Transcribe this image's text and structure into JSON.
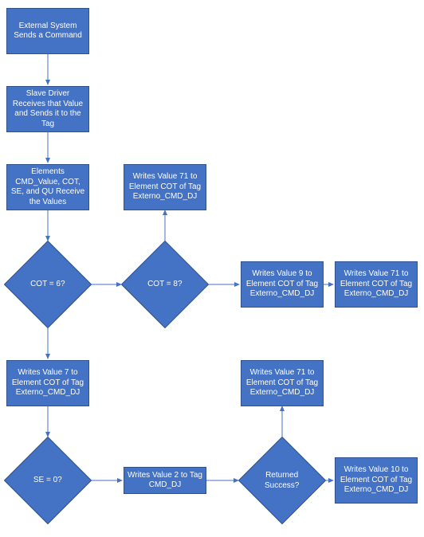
{
  "nodes": {
    "n1": "External System Sends a Command",
    "n2": "Slave Driver Receives that Value and Sends it to the Tag",
    "n3": "Elements CMD_Value, COT, SE, and QU Receive the Values",
    "n4": "Writes Value 71 to Element COT of Tag Externo_CMD_DJ",
    "d1": "COT = 6?",
    "d2": "COT = 8?",
    "n5": "Writes Value 9 to Element COT of Tag Externo_CMD_DJ",
    "n6": "Writes Value 71 to Element COT of Tag Externo_CMD_DJ",
    "n7": "Writes Value 7 to Element COT of Tag Externo_CMD_DJ",
    "d3": "SE = 0?",
    "n8": "Writes Value 2 to Tag CMD_DJ",
    "d4": "Returned Success?",
    "n9": "Writes Value 71 to Element COT of Tag Externo_CMD_DJ",
    "n10": "Writes Value 10 to Element COT of Tag Externo_CMD_DJ"
  }
}
